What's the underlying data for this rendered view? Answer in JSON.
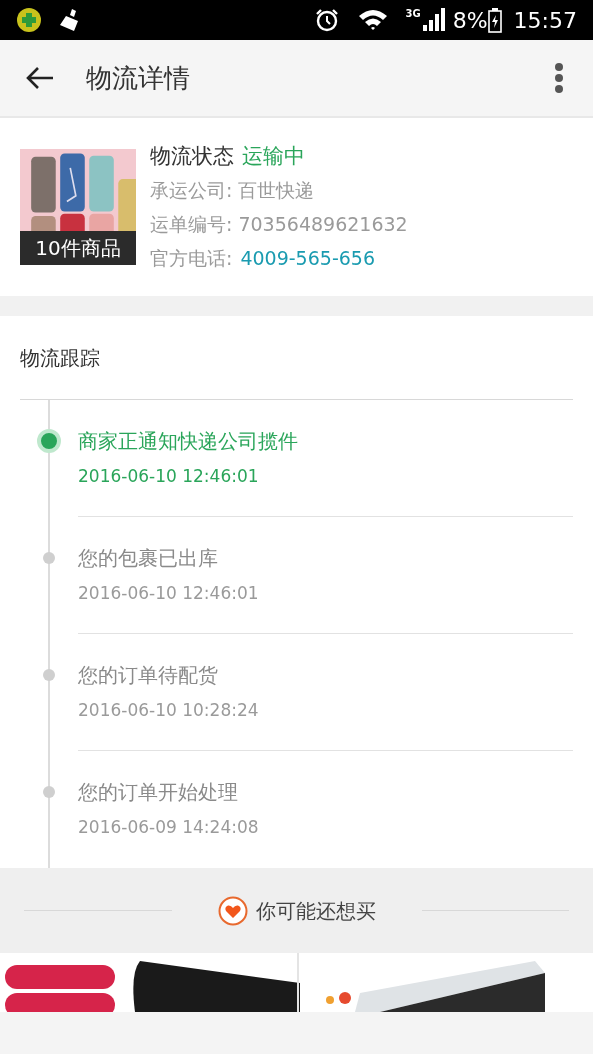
{
  "status_bar": {
    "network": "3G",
    "battery": "8%",
    "time": "15:57"
  },
  "header": {
    "title": "物流详情"
  },
  "shipment": {
    "item_count": "10件商品",
    "status_label": "物流状态",
    "status": "运输中",
    "carrier": "承运公司: 百世快递",
    "waybill": "运单编号: 70356489621632",
    "phone_label": "官方电话:",
    "phone": "4009-565-656"
  },
  "tracking": {
    "title": "物流跟踪",
    "events": [
      {
        "text": "商家正通知快递公司揽件",
        "time": "2016-06-10 12:46:01",
        "current": true
      },
      {
        "text": "您的包裹已出库",
        "time": "2016-06-10 12:46:01",
        "current": false
      },
      {
        "text": "您的订单待配货",
        "time": "2016-06-10 10:28:24",
        "current": false
      },
      {
        "text": "您的订单开始处理",
        "time": "2016-06-09 14:24:08",
        "current": false
      }
    ]
  },
  "recommend": {
    "title": "你可能还想买"
  }
}
